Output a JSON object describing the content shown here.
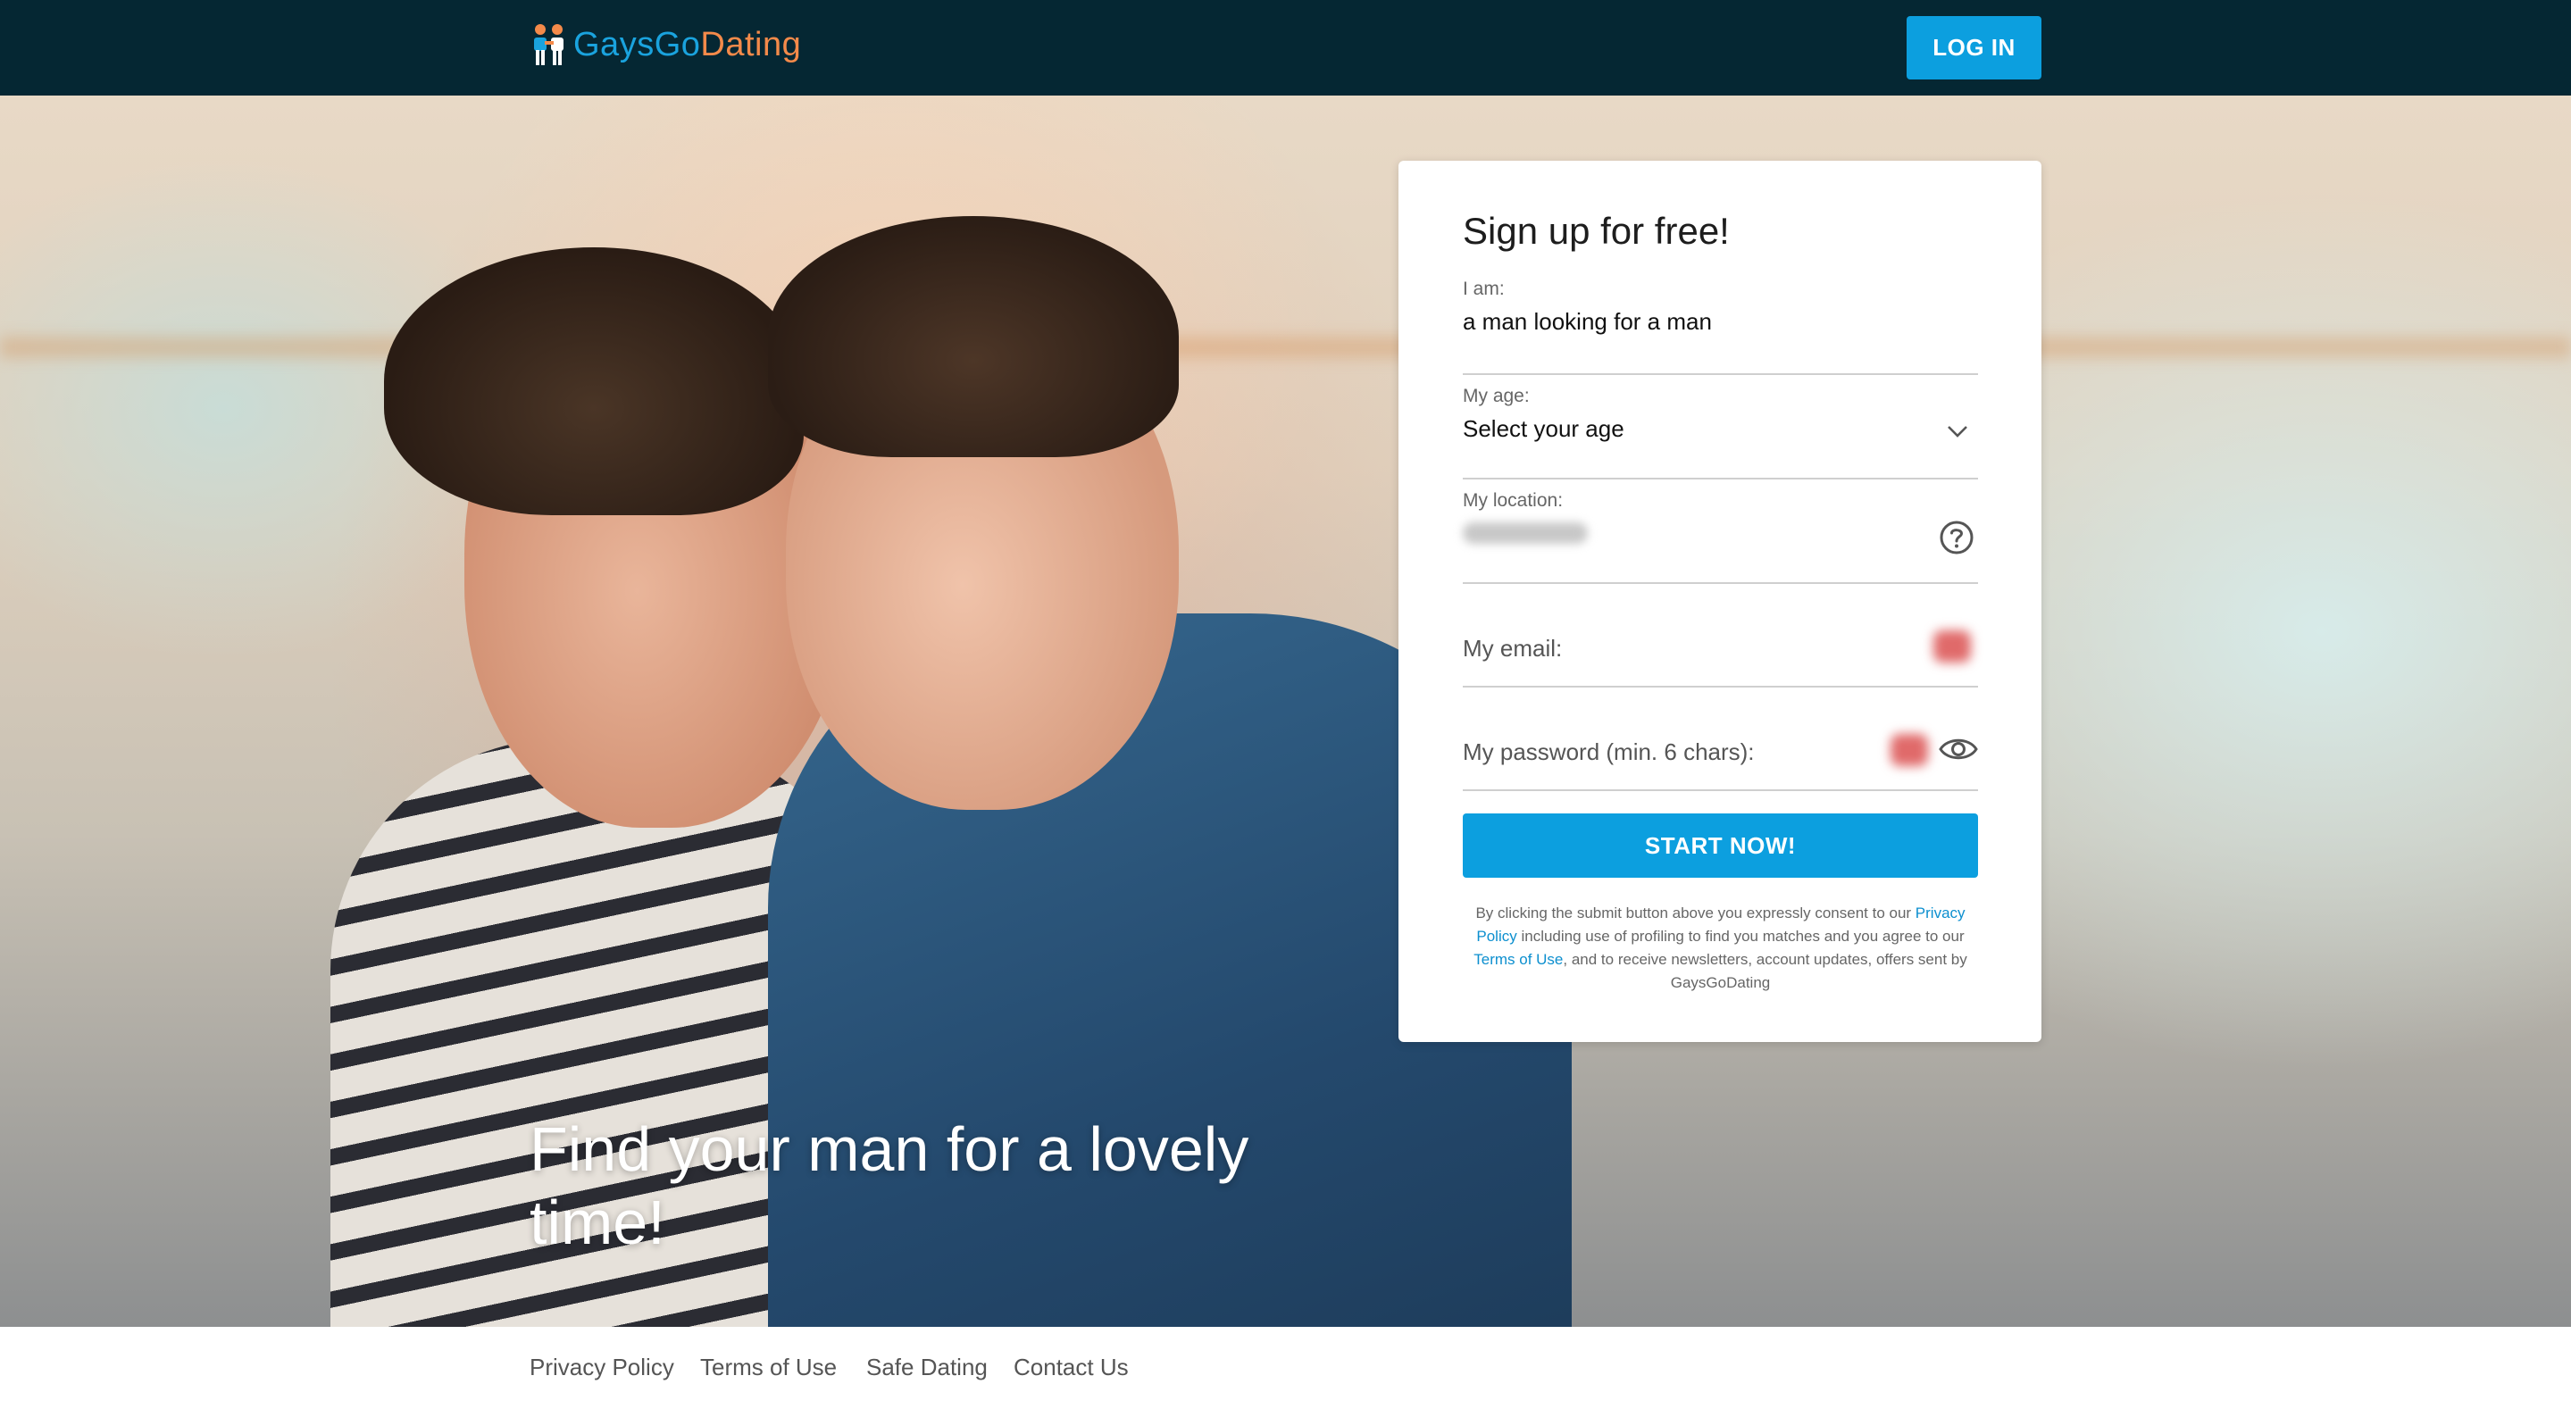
{
  "header": {
    "logo_part1": "Gays",
    "logo_part2": "Go",
    "logo_part3": "Dating",
    "login_label": "LOG IN"
  },
  "hero": {
    "headline": "Find your man for a lovely time!"
  },
  "signup": {
    "title": "Sign up for free!",
    "iam_label": "I am:",
    "iam_value": "a man looking for a man",
    "age_label": "My age:",
    "age_value": "Select your age",
    "location_label": "My location:",
    "email_placeholder": "My email:",
    "password_placeholder": "My password (min. 6 chars):",
    "submit_label": "START NOW!",
    "consent": {
      "part1": "By clicking the submit button above you expressly consent to our ",
      "privacy_link": "Privacy Policy",
      "part2": " including use of profiling to find you matches and you agree to our ",
      "terms_link": "Terms of Use",
      "part3": ", and to receive newsletters, account updates, offers sent by GaysGoDating"
    }
  },
  "footer": {
    "links": [
      "Privacy Policy",
      "Terms of Use",
      "Safe Dating",
      "Contact Us"
    ]
  },
  "colors": {
    "header_bg": "#052733",
    "accent": "#0c9fdf",
    "logo_orange": "#f48a4a"
  },
  "icons": [
    "logo-couple-icon",
    "chevron-down-icon",
    "help-circle-icon",
    "eye-icon"
  ]
}
